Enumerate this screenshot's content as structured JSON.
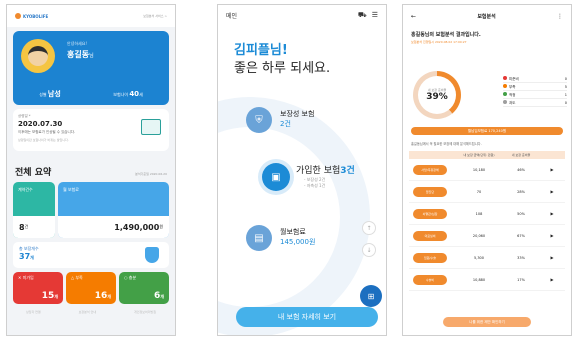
{
  "screen1": {
    "logo_text": "KYOBOLIFE",
    "header_right": "보험분석 서비스 >",
    "profile": {
      "greeting": "안녕하세요!",
      "name": "홍길동",
      "name_suffix": "님",
      "gender_label": "성별",
      "gender": "남성",
      "age_label": "보험나이",
      "age": "40",
      "age_unit": "세"
    },
    "notice": {
      "label": "상령일 *",
      "date": "2020.07.30",
      "message": "이후에는 보험료가 인상될 수 있습니다.",
      "sub": "상령일이란 보험나이가 바뀌는 날입니다."
    },
    "summary": {
      "title": "전체 요약",
      "date_text": "분석기준일 2020.06.20"
    },
    "contract_card": {
      "label": "계약건수",
      "value": "8",
      "unit": "건"
    },
    "premium_card": {
      "label": "월 보험료",
      "value": "1,490,000",
      "unit": "원"
    },
    "coverage": {
      "label": "총 보장개수",
      "value": "37",
      "unit": "개"
    },
    "status": [
      {
        "label": "미가입",
        "icon": "✕",
        "value": "15",
        "unit": "개"
      },
      {
        "label": "부족",
        "icon": "△",
        "value": "16",
        "unit": "개"
      },
      {
        "label": "충분",
        "icon": "○",
        "value": "6",
        "unit": "개"
      }
    ],
    "footer_links": [
      "상담자 연결",
      "보장분석 안내",
      "개인정보처리방침"
    ]
  },
  "screen2": {
    "title": "메인",
    "hello_line1": "김피플님!",
    "hello_line2": "좋은 하루 되세요.",
    "coverage_label": "보장성 보험",
    "coverage_value": "2건",
    "joined_label": "가입한 보험",
    "joined_value": "3건",
    "joined_sub1": "- 보장성 2건",
    "joined_sub2": "- 저축성 1건",
    "premium_label": "월보험료",
    "premium_value": "145,000원",
    "detail_button": "내 보험 자세히 보기"
  },
  "screen3": {
    "title": "보험분석",
    "result_title": "홍길동님의 보험분석 결과입니다.",
    "result_sub": "보험분석 진행일시 2020.08.02 17:00:27",
    "donut_label": "내 보장 준비율",
    "donut_value": "39%",
    "donut_percent": 39,
    "legend": [
      {
        "label": "미준비",
        "value": "0",
        "color": "#e53935"
      },
      {
        "label": "부족",
        "value": "5",
        "color": "#f57c00"
      },
      {
        "label": "적정",
        "value": "1",
        "color": "#43a047"
      },
      {
        "label": "과도",
        "value": "0",
        "color": "#9e9e9e"
      }
    ],
    "monthly_text": "월납입보험료 170,240원",
    "note": "홍길동님께서 꼭 필요한 보장에 대해 분석해드립니다.",
    "table_headers": [
      "",
      "내 보장 금액(단위: 만원)",
      "내 보장 준비율",
      ""
    ],
    "rows": [
      {
        "name": "사망/후유장해",
        "amount": "10,180",
        "rate": "46%"
      },
      {
        "name": "암진단",
        "amount": "70",
        "rate": "28%"
      },
      {
        "name": "뇌혈관/심장",
        "amount": "108",
        "rate": "50%"
      },
      {
        "name": "의료실비",
        "amount": "20,060",
        "rate": "67%"
      },
      {
        "name": "입원/수술",
        "amount": "5,300",
        "rate": "33%"
      },
      {
        "name": "수술비",
        "amount": "10,880",
        "rate": "17%"
      }
    ],
    "bottom_button": "나를 위한 제안 확인하기"
  }
}
